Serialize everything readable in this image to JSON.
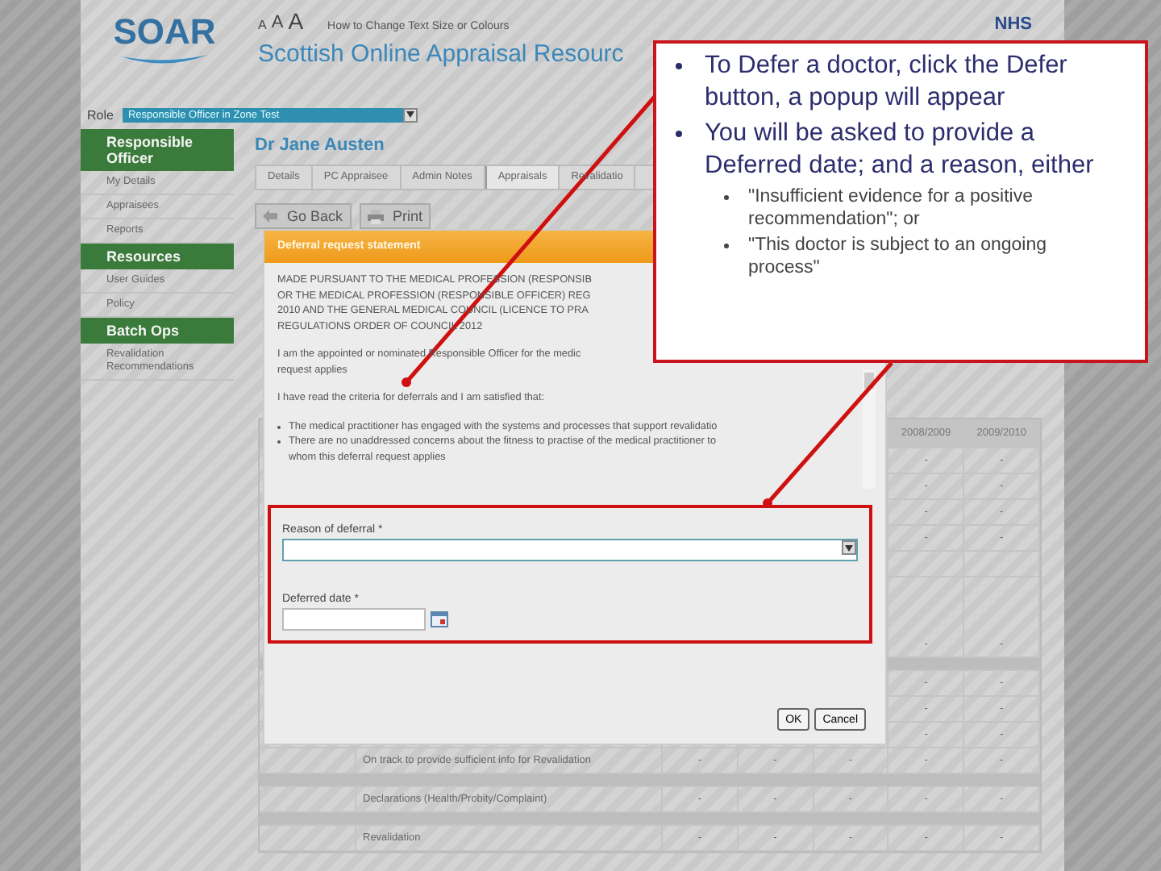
{
  "header": {
    "logo": "SOAR",
    "text_size_buttons": [
      "A",
      "A",
      "A"
    ],
    "text_size_link": "How to Change Text Size or Colours",
    "site_title": "Scottish Online Appraisal Resourc",
    "nhs_logo": "NHS"
  },
  "role": {
    "label": "Role",
    "value": "Responsible Officer in Zone Test"
  },
  "sidebar": {
    "sections": [
      {
        "title": "Responsible Officer",
        "items": [
          "My Details",
          "Appraisees",
          "Reports"
        ]
      },
      {
        "title": "Resources",
        "items": [
          "User Guides",
          "Policy"
        ]
      },
      {
        "title": "Batch Ops",
        "items": [
          "Revalidation Recommendations"
        ]
      }
    ]
  },
  "doctor_name": "Dr Jane Austen",
  "tabs": [
    {
      "label": "Details",
      "selected": false
    },
    {
      "label": "PC Appraisee",
      "selected": false
    },
    {
      "label": "Admin Notes",
      "selected": false
    },
    {
      "label": "Appraisals",
      "selected": true
    },
    {
      "label": "Revalidatio",
      "selected": false
    }
  ],
  "toolbar": [
    {
      "label": "Go Back",
      "kind": "back"
    },
    {
      "label": "Print",
      "kind": "print"
    }
  ],
  "table": {
    "headers": [
      "2008/2009",
      "2009/2010"
    ],
    "rows": [
      {
        "kind": "row",
        "cells": [
          "-",
          "-"
        ]
      },
      {
        "kind": "row",
        "cells": [
          "-",
          "-"
        ]
      },
      {
        "kind": "row",
        "cells": [
          "-",
          "-"
        ]
      },
      {
        "kind": "row",
        "cells": [
          "-",
          "-"
        ]
      },
      {
        "kind": "row"
      },
      {
        "kind": "tall",
        "cells": [
          "-",
          "-"
        ]
      },
      {
        "kind": "section"
      },
      {
        "kind": "row",
        "cells": [
          "-",
          "-"
        ]
      },
      {
        "kind": "row",
        "cells": [
          "-",
          "-"
        ]
      },
      {
        "kind": "row",
        "cells": [
          "-",
          "-"
        ]
      },
      {
        "kind": "row",
        "label": "On track to provide sufficient info for Revalidation",
        "cells": [
          "-",
          "-",
          "-",
          "-",
          "-"
        ]
      },
      {
        "kind": "section"
      },
      {
        "kind": "row",
        "label": "Declarations (Health/Probity/Complaint)",
        "cells": [
          "-",
          "-",
          "-",
          "-",
          "-"
        ]
      },
      {
        "kind": "section"
      },
      {
        "kind": "row",
        "label": "Revalidation",
        "cells": [
          "-",
          "-",
          "-",
          "-",
          "-"
        ]
      }
    ]
  },
  "dialog": {
    "title": "Deferral request statement",
    "statement": [
      {
        "kind": "paragraph",
        "lines": [
          "MADE PURSUANT TO THE MEDICAL PROFESSION (RESPONSIB",
          "OR THE MEDICAL PROFESSION (RESPONSIBLE OFFICER) REG",
          "2010 AND THE GENERAL MEDICAL COUNCIL (LICENCE TO PRA",
          "REGULATIONS ORDER OF COUNCIL 2012"
        ]
      },
      {
        "kind": "paragraph",
        "lines": [
          "I am the appointed or nominated Responsible Officer for the medic",
          "request applies"
        ]
      },
      {
        "kind": "paragraph",
        "lines": [
          "I have read the criteria for deferrals and I am satisfied that:"
        ]
      },
      {
        "kind": "bullet",
        "lines": [
          "The medical practitioner has engaged with the systems and processes that support revalidatio"
        ]
      },
      {
        "kind": "bullet",
        "lines": [
          "There are no unaddressed concerns about the fitness to practise of the medical practitioner to",
          "whom this deferral request applies"
        ]
      }
    ],
    "reason_label": "Reason of deferral *",
    "date_label": "Deferred date *",
    "buttons": [
      "OK",
      "Cancel"
    ]
  },
  "callout": {
    "bullets": [
      {
        "text": "To Defer a doctor, click the Defer button, a popup will appear"
      },
      {
        "text": "You will be asked to provide a Deferred date; and a reason, either",
        "children": [
          "\"Insufficient evidence for a positive recommendation\"; or",
          "\"This doctor is subject to an ongoing process\""
        ]
      }
    ]
  }
}
